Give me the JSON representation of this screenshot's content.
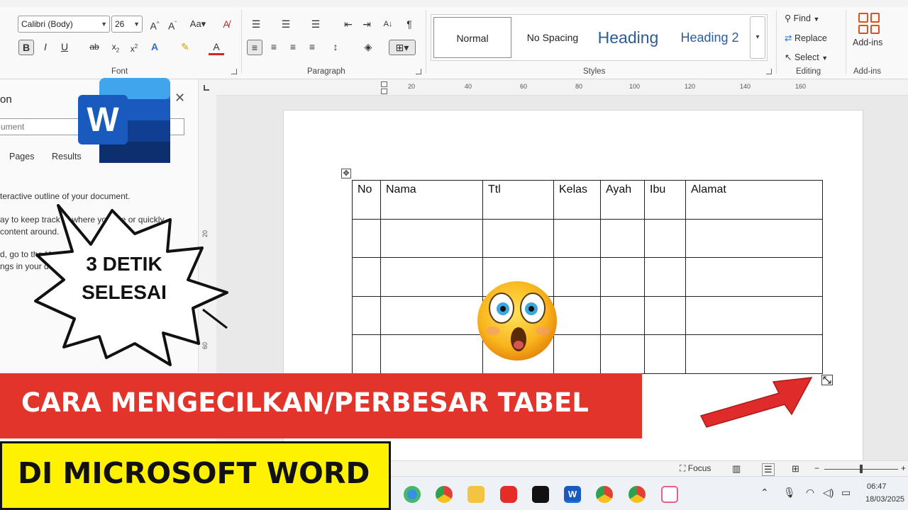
{
  "ribbon": {
    "font_name": "Calibri (Body)",
    "font_size": "26",
    "font_group_label": "Font",
    "paragraph_group_label": "Paragraph",
    "styles_group_label": "Styles",
    "editing_group_label": "Editing",
    "addins_group_label": "Add-ins",
    "styles": [
      "Normal",
      "No Spacing",
      "Heading",
      "Heading 2"
    ],
    "find_label": "Find",
    "replace_label": "Replace",
    "select_label": "Select",
    "addins_button_label": "Add-ins"
  },
  "ruler": {
    "h_numbers": [
      "20",
      "40",
      "60",
      "80",
      "100",
      "120",
      "140",
      "160"
    ],
    "v_numbers": [
      "20",
      "40",
      "60"
    ]
  },
  "nav_pane": {
    "title": "on",
    "search_placeholder": "ument",
    "tabs": [
      "Pages",
      "Results"
    ],
    "lines": [
      "teractive outline of your document.",
      "ay to keep track of where you are or quickly",
      "content around.",
      "d, go to the Home tab and apply Heading styles to",
      "ngs in your document."
    ]
  },
  "table": {
    "headers": [
      "No",
      "Nama",
      "Ttl",
      "Kelas",
      "Ayah",
      "Ibu",
      "Alamat"
    ],
    "empty_rows": 4
  },
  "status_bar": {
    "focus_label": "Focus",
    "zoom_minus": "−",
    "zoom_plus": "+",
    "zoom_level": 0.5
  },
  "taskbar": {
    "time": "06:47",
    "date": "18/03/2025"
  },
  "overlay": {
    "burst_line1": "3 DETIK",
    "burst_line2": "SELESAI",
    "red_banner": "CARA MENGECILKAN/PERBESAR TABEL",
    "yellow_banner": "DI MICROSOFT WORD",
    "logo_letter": "W"
  },
  "colors": {
    "red_banner": "#e3342b",
    "yellow_banner": "#fff200",
    "word_blue": "#185abd",
    "arrow_red": "#e02b2b"
  }
}
